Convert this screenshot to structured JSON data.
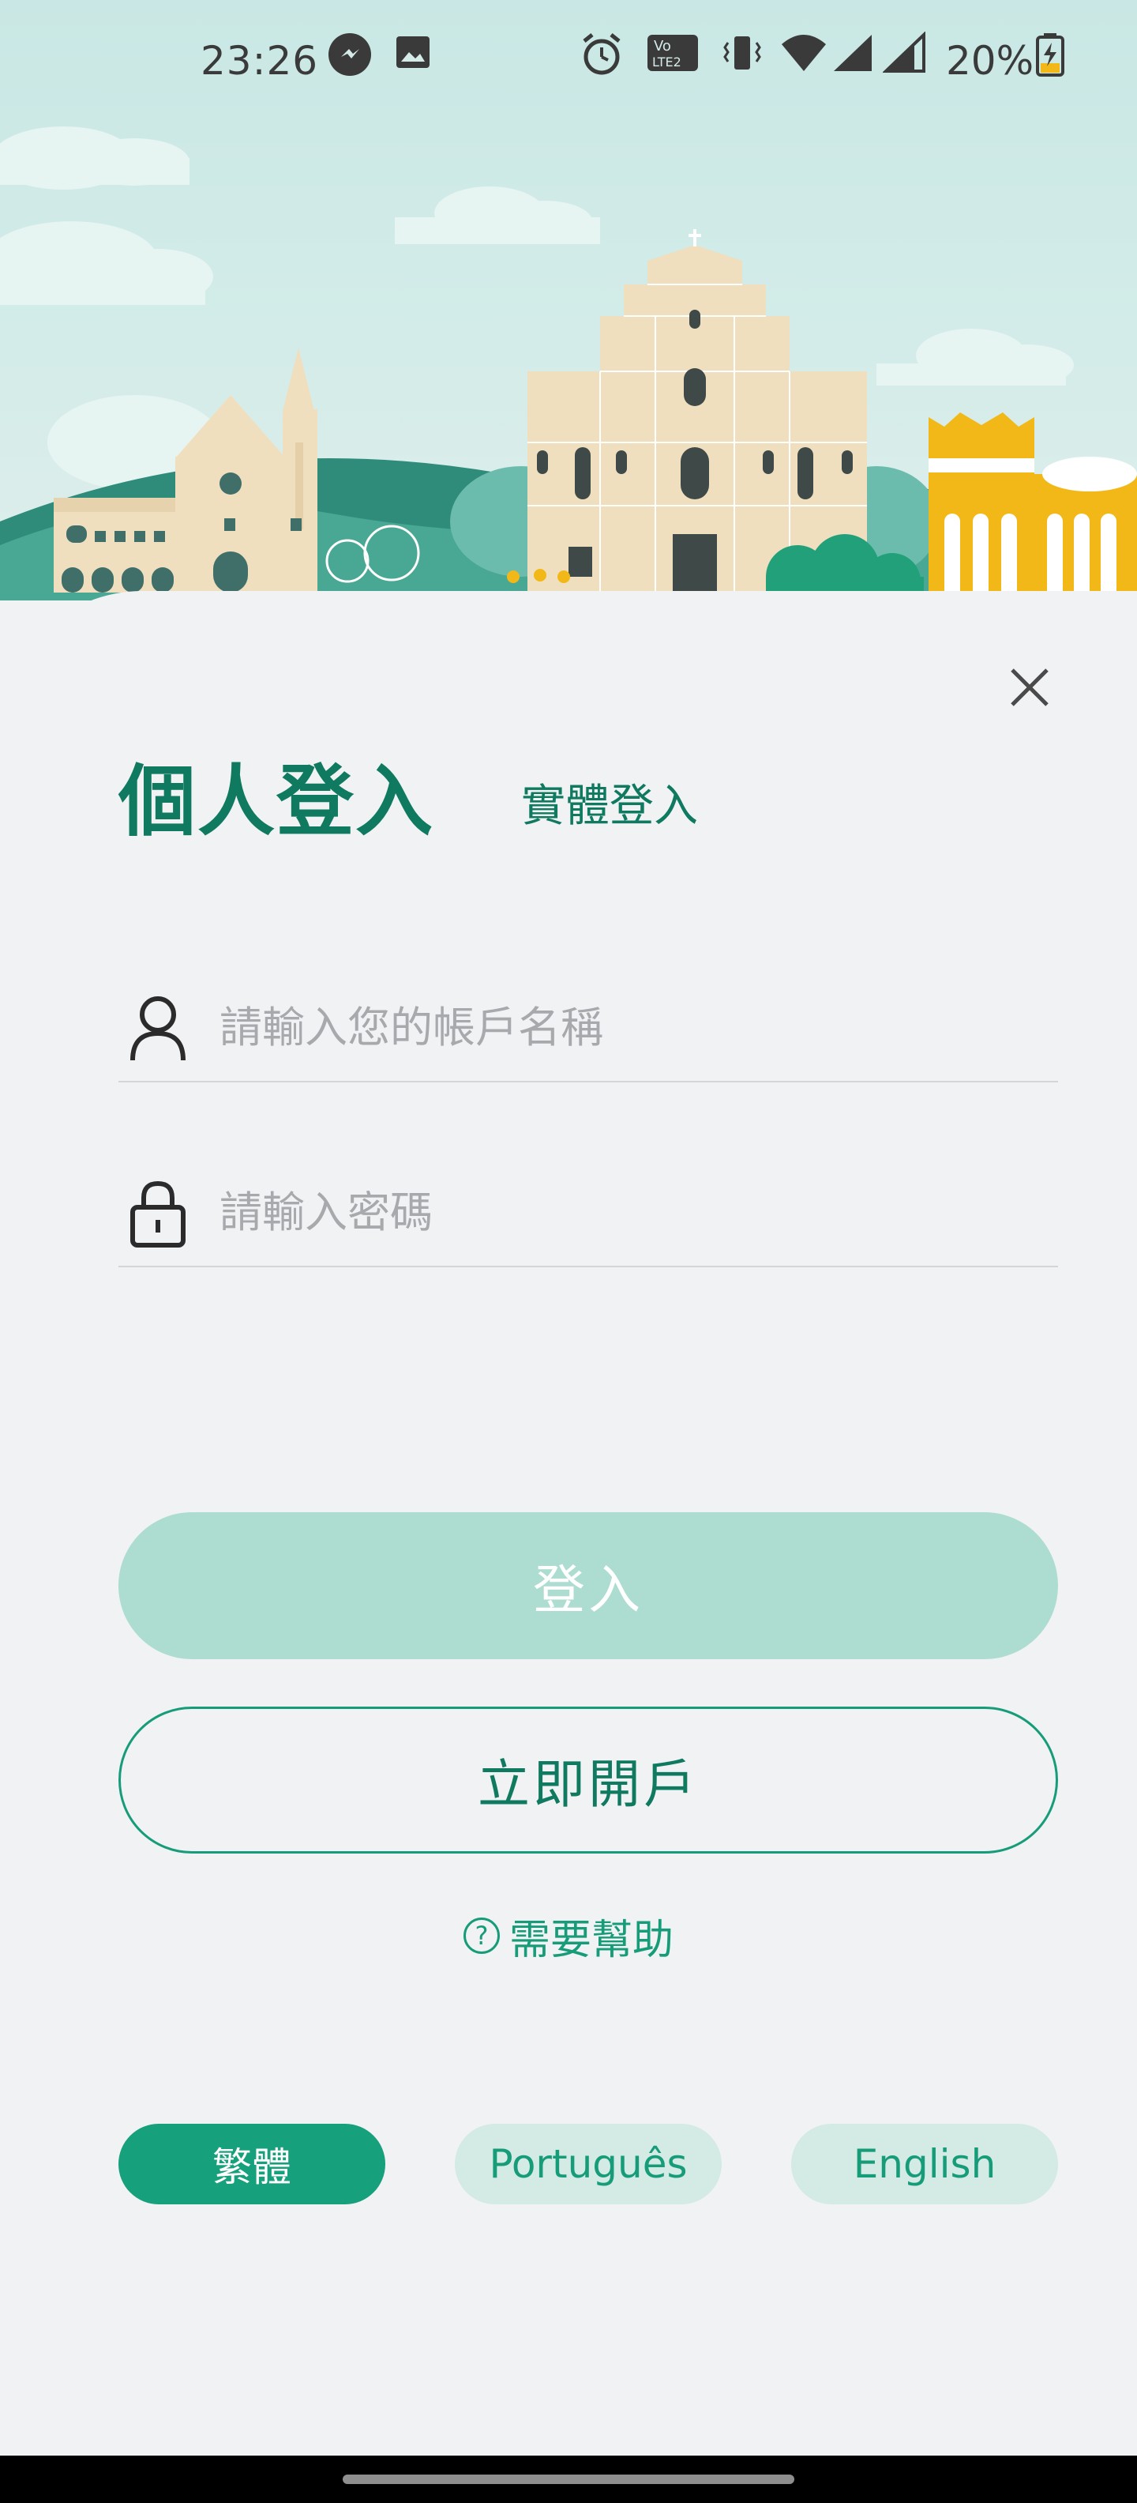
{
  "status_bar": {
    "time": "23:26",
    "battery_percent": "20%",
    "icons": [
      "messenger-icon",
      "image-icon",
      "alarm-icon",
      "volte-icon",
      "vibrate-icon",
      "wifi-icon",
      "signal-icon",
      "signal-icon",
      "battery-charging-icon"
    ]
  },
  "login": {
    "tab_personal": "個人登入",
    "tab_entity": "實體登入",
    "username_placeholder": "請輸入您的帳戶名稱",
    "password_placeholder": "請輸入密碼",
    "login_button": "登入",
    "register_button": "立即開戶",
    "help_label": "需要幫助",
    "help_icon_glyph": "?"
  },
  "languages": [
    {
      "label": "繁體",
      "active": true
    },
    {
      "label": "Português",
      "active": false
    },
    {
      "label": "English",
      "active": false
    }
  ],
  "colors": {
    "brand": "#0f7a60",
    "accent": "#17a07c",
    "button_disabled": "#addcd0",
    "chip_inactive": "#d3ebe4",
    "background": "#f1f2f4"
  }
}
